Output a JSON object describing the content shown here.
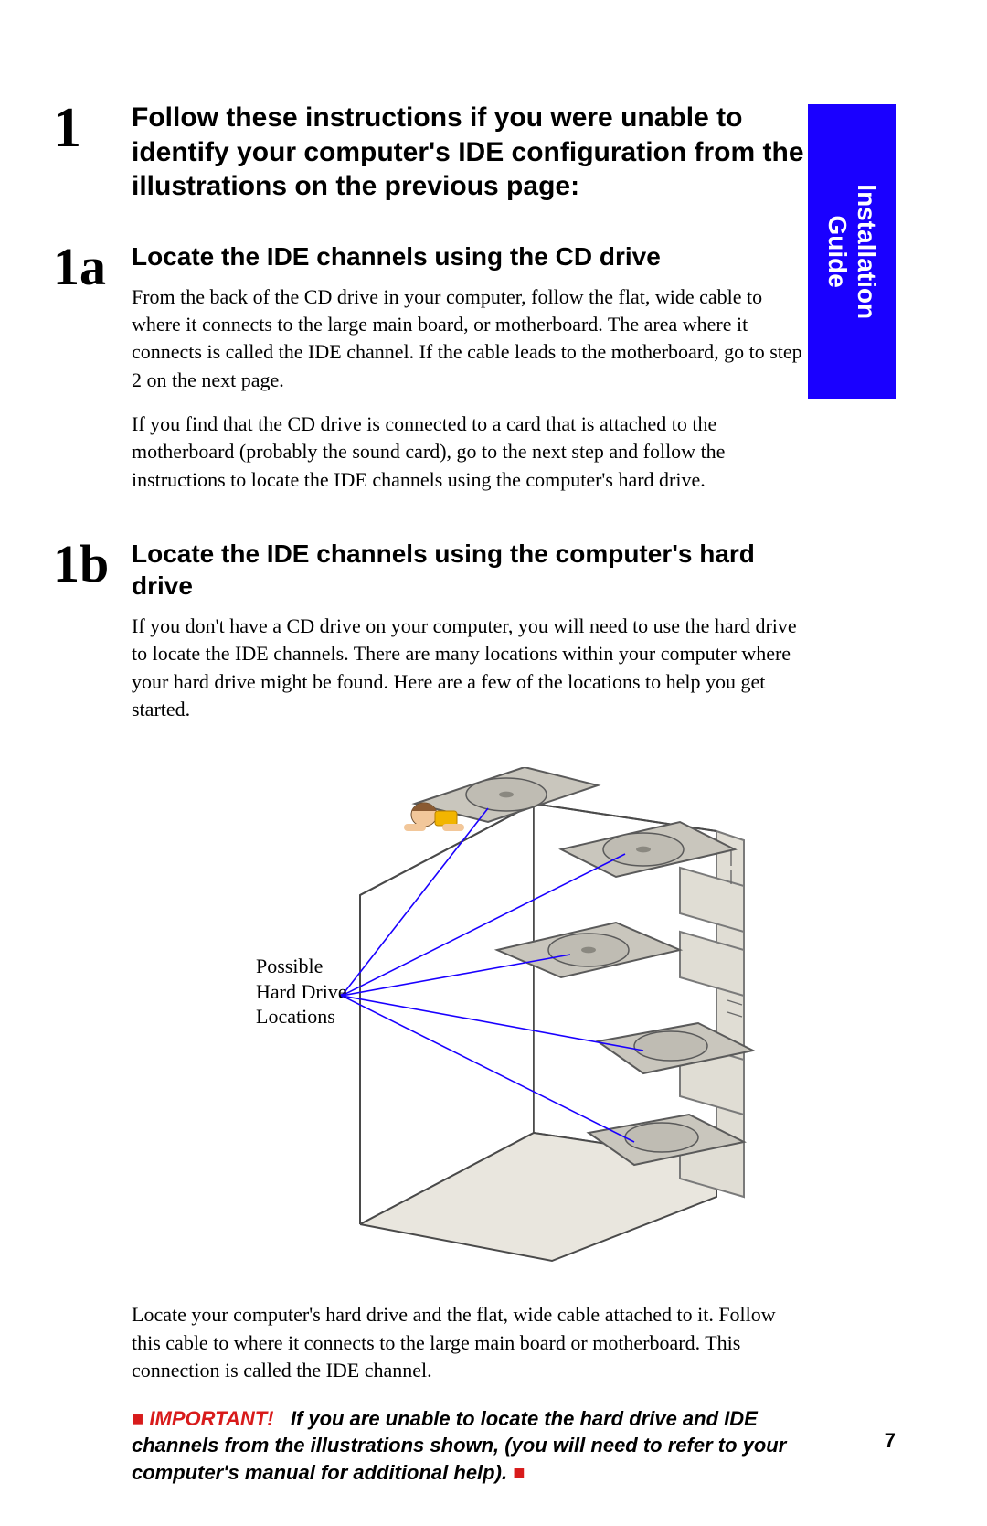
{
  "sideTab": {
    "line1": "Installation",
    "line2": "Guide"
  },
  "step1": {
    "num": "1",
    "title": "Follow these instructions if you were unable to identify your computer's IDE configuration from the illustrations on the previous page:"
  },
  "step1a": {
    "num": "1a",
    "title": "Locate the IDE channels using the CD drive",
    "p1": "From the back of the CD drive in your computer, follow the flat, wide cable to where it connects to the large main board, or motherboard.  The area where it connects is called the IDE channel. If the cable leads to the motherboard, go to step 2 on the next page.",
    "p2": "If you find that the CD drive is connected to a card that is attached to the motherboard (probably the sound card), go to the next step and follow the instructions to locate the IDE channels using the computer's hard drive."
  },
  "step1b": {
    "num": "1b",
    "title": "Locate the IDE channels using the computer's hard drive",
    "p1": "If you don't have a CD drive on your computer, you will need to use the hard drive to locate the IDE channels.  There are many locations within your computer where your hard drive might be found.  Here are a few of the locations to help you get started.",
    "p2": "Locate your computer's hard drive and the flat, wide cable attached to it.  Follow this cable to where it connects to the large main board or motherboard.  This connection is called the IDE channel."
  },
  "figure": {
    "label_l1": "Possible",
    "label_l2": "Hard Drive",
    "label_l3": "Locations"
  },
  "important": {
    "square": "■",
    "keyword": "IMPORTANT!",
    "text": "If you are unable to locate the hard drive and IDE channels from the illustrations shown, (you will need to refer to your computer's manual for additional help)."
  },
  "pageNumber": "7"
}
